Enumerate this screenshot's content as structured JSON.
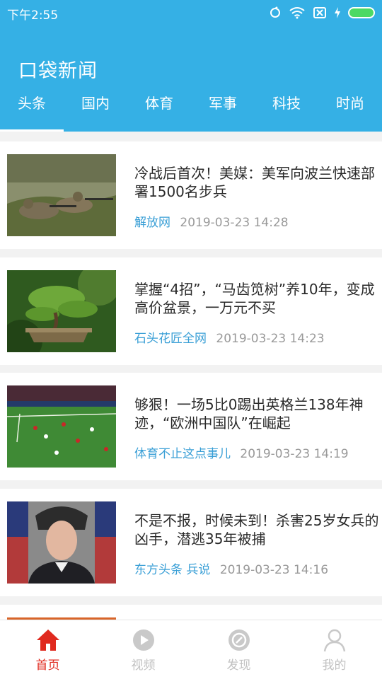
{
  "status_bar": {
    "time": "下午2:55"
  },
  "header": {
    "title": "口袋新闻",
    "color": "#35b0e5",
    "tabs": [
      {
        "label": "头条",
        "active": true
      },
      {
        "label": "国内",
        "active": false
      },
      {
        "label": "体育",
        "active": false
      },
      {
        "label": "军事",
        "active": false
      },
      {
        "label": "科技",
        "active": false
      },
      {
        "label": "时尚",
        "active": false
      }
    ]
  },
  "news": [
    {
      "title": "冷战后首次！美媒：美军向波兰快速部署1500名步兵",
      "source": "解放网",
      "time": "2019-03-23 14:28",
      "thumb": "soldiers-image"
    },
    {
      "title": "掌握“4招”，“马齿笕树”养10年，变成高价盆景，一万元不买",
      "source": "石头花匠全网",
      "time": "2019-03-23 14:23",
      "thumb": "bonsai-image"
    },
    {
      "title": "够狠！一场5比0踢出英格兰138年神迹，“欧洲中国队”在崛起",
      "source": "体育不止这点事儿",
      "time": "2019-03-23 14:19",
      "thumb": "football-image"
    },
    {
      "title": "不是不报，时候未到！杀害25岁女兵的凶手，潜逃35年被捕",
      "source": "东方头条 兵说",
      "time": "2019-03-23 14:16",
      "thumb": "portrait-image"
    }
  ],
  "bottom_nav": {
    "active_color": "#e02a1f",
    "items": [
      {
        "label": "首页",
        "icon": "home-icon",
        "active": true
      },
      {
        "label": "视频",
        "icon": "play-icon",
        "active": false
      },
      {
        "label": "发现",
        "icon": "compass-icon",
        "active": false
      },
      {
        "label": "我的",
        "icon": "user-icon",
        "active": false
      }
    ]
  }
}
